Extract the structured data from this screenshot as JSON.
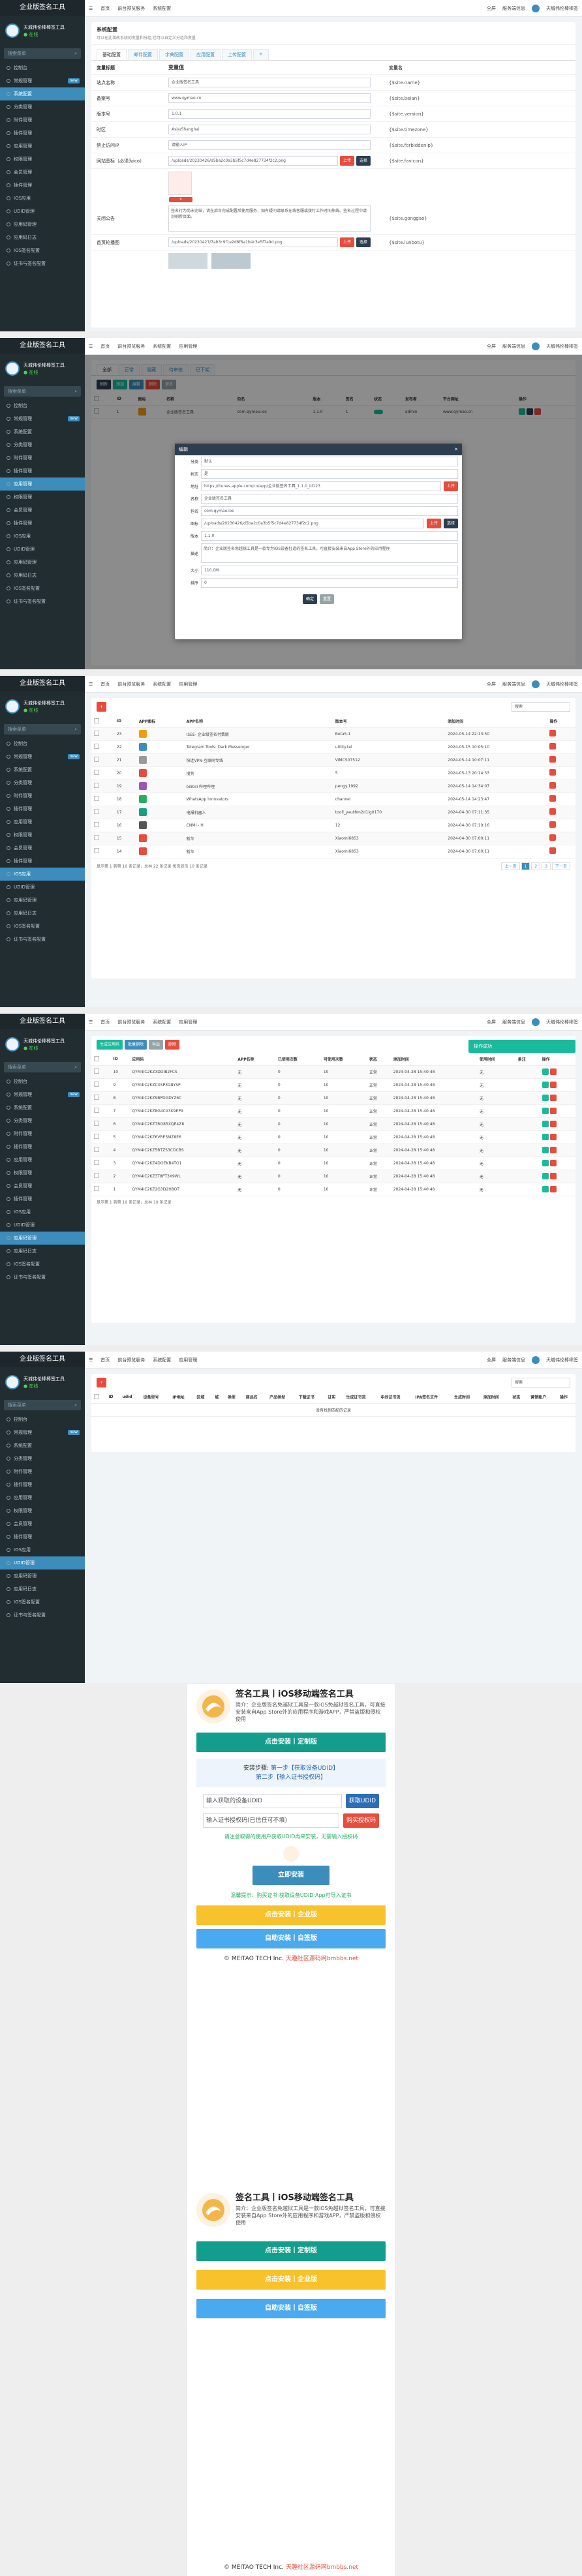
{
  "app": {
    "brand": "企业版签名工具",
    "user_line1": "天城伟伦棒棒签工具",
    "online": "● 在线",
    "search_placeholder": "搜索菜单",
    "topnav": [
      "首页",
      "前台预览服务",
      "系统配置"
    ],
    "topnav_extra": "应用管理",
    "top_right": [
      "全屏",
      "服务端信息",
      "天城伟伦棒棒签"
    ]
  },
  "sidebar": [
    {
      "label": "控制台",
      "badge": ""
    },
    {
      "label": "常规管理",
      "badge": "new"
    },
    {
      "label": "系统配置",
      "badge": ""
    },
    {
      "label": "分类管理",
      "badge": ""
    },
    {
      "label": "附件管理",
      "badge": ""
    },
    {
      "label": "插件管理",
      "badge": ""
    },
    {
      "label": "应用管理",
      "badge": ""
    },
    {
      "label": "权限管理",
      "badge": ""
    },
    {
      "label": "会员管理",
      "badge": ""
    },
    {
      "label": "插件管理",
      "badge": ""
    },
    {
      "label": "IOS应用",
      "badge": ""
    },
    {
      "label": "UDID管理",
      "badge": ""
    },
    {
      "label": "应用码管理",
      "badge": ""
    },
    {
      "label": "应用码日志",
      "badge": ""
    },
    {
      "label": "IOS签名配置",
      "badge": ""
    },
    {
      "label": "证书与签名配置",
      "badge": ""
    }
  ],
  "s1": {
    "title": "系统配置",
    "subtitle": "可以在此增改系统的变量和分组,也可以自定义分组和变量",
    "tabs": [
      "基础配置",
      "邮件配置",
      "字典配置",
      "应用配置",
      "上传配置",
      "+"
    ],
    "cols": [
      "变量标题",
      "变量值",
      "变量名"
    ],
    "rows": [
      {
        "label": "站点名称",
        "value": "企业版签名工具",
        "name": "{$site.name}"
      },
      {
        "label": "备案号",
        "value": "www.qymao.cn",
        "name": "{$site.beian}"
      },
      {
        "label": "版本号",
        "value": "1.0.1",
        "name": "{$site.version}"
      },
      {
        "label": "时区",
        "value": "Asia/Shanghai",
        "name": "{$site.timezone}"
      },
      {
        "label": "禁止访问IP",
        "value": "请输入IP",
        "name": "{$site.forbiddenip}"
      },
      {
        "label": "网站图标（必须为ico）",
        "value": "/uploads/20230426/d5ba2c0a3b5f5c7d4e827734f2c2.png",
        "name": "{$site.favicon}"
      },
      {
        "label": "关闭公告",
        "value": "签名行为尚未完结，请在后台完成配置后使用服务，如有疑问请联系在线客服或拨打工作时间热线。签名过程中请勿刷新页面。",
        "name": "{$site.gonggao}"
      },
      {
        "label": "首页轮播图",
        "value": "/uploads/20230427/7ab3c9f1e2d8f6a1b4c3e5f7a9d.png",
        "name": "{$site.lunbotu}"
      }
    ],
    "btn_upload": "上传",
    "btn_choose": "选择"
  },
  "s2": {
    "tabs": [
      "全部",
      "正常",
      "隐藏",
      "待审核",
      "已下架"
    ],
    "tool": [
      "刷新",
      "添加",
      "编辑",
      "删除",
      "更多"
    ],
    "cols": [
      "ID",
      "图标",
      "名称",
      "包名",
      "版本",
      "签名",
      "状态",
      "发布者",
      "平台网址",
      "操作"
    ],
    "row": {
      "id": "1",
      "name": "企业版签名工具",
      "bundle": "com.qymao.ios",
      "ver": "1.1.0",
      "sign": "1",
      "status": "正常",
      "pub": "admin",
      "url": "www.qymao.cn",
      "plat": "企业版签名工具"
    },
    "modal": {
      "title": "编辑",
      "fields": [
        {
          "label": "分类",
          "value": "默认"
        },
        {
          "label": "状态",
          "value": "是"
        },
        {
          "label": "地址",
          "value": "https://itunes.apple.com/cn/app/企业版签名工具_1.1.0_id123"
        },
        {
          "label": "名称",
          "value": "企业版签名工具"
        },
        {
          "label": "包名",
          "value": "com.qymao.ios"
        },
        {
          "label": "图标",
          "value": "/uploads/20230426/d5ba2c0a3b5f5c7d4e827734f2c2.png"
        },
        {
          "label": "版本",
          "value": "1.1.0"
        },
        {
          "label": "描述",
          "value": "简介：企业版签名免越狱工具是一款专为iOS设备打造的签名工具，可直接安装来自App Store外的应用程序"
        },
        {
          "label": "大小",
          "value": "110.0M"
        },
        {
          "label": "排序",
          "value": "0"
        }
      ],
      "ok": "确定",
      "reset": "重置"
    }
  },
  "s3": {
    "search": "搜索",
    "cols": [
      "ID",
      "APP图标",
      "APP名称",
      "版本号",
      "添加时间",
      "操作"
    ],
    "rows": [
      {
        "id": "23",
        "name": "ISEE- 企业级签名付费版",
        "ver": "Beta5.1",
        "time": "2024-05-14 22:13:50",
        "color": "#f39c12"
      },
      {
        "id": "22",
        "name": "Telegram Tools: Dark Messenger",
        "ver": "utility.tel",
        "time": "2024-05-15 10:05:10",
        "color": "#3c8dbc"
      },
      {
        "id": "21",
        "name": "快连VPN-互联网专线",
        "ver": "ViMCS07512",
        "time": "2024-05-14 10:07:11",
        "color": "#999"
      },
      {
        "id": "20",
        "name": "搜狗",
        "ver": "5",
        "time": "2024-05-13 20:14:33",
        "color": "#e74c3c"
      },
      {
        "id": "19",
        "name": "bilibili 哔哩哔哩",
        "ver": "pengy.1992",
        "time": "2024-05-14 14:34:07",
        "color": "#9b59b6"
      },
      {
        "id": "18",
        "name": "WhatsApp Innovators",
        "ver": "channel",
        "time": "2024-05-14 14:23:47",
        "color": "#27ae60"
      },
      {
        "id": "17",
        "name": "电报机器人",
        "ver": "tooll_yaut8m2d1ig0170",
        "time": "2024-04-30 07:11:35",
        "color": "#16a085"
      },
      {
        "id": "16",
        "name": "CNMI - H",
        "ver": "12",
        "time": "2024-04-30 07:10:16",
        "color": "#555"
      },
      {
        "id": "15",
        "name": "新华",
        "ver": "Xiaomi6853",
        "time": "2024-04-30 07:00:11",
        "color": "#e74c3c"
      },
      {
        "id": "14",
        "name": "新华",
        "ver": "Xiaomi6853",
        "time": "2024-04-30 07:00:11",
        "color": "#e74c3c"
      }
    ],
    "footer": "显示第 1 到第 10 条记录，总共 22 条记录 每页显示 10 条记录",
    "pages": [
      "上一页",
      "1",
      "2",
      "3",
      "下一页"
    ]
  },
  "s4": {
    "tool": [
      "生成应用码",
      "批量删除",
      "导出",
      "删除"
    ],
    "notice": "操作成功",
    "cols": [
      "ID",
      "应用码",
      "APP名称",
      "已使用次数",
      "可使用次数",
      "状态",
      "添加时间",
      "使用时间",
      "备注",
      "操作"
    ],
    "rows": [
      {
        "id": "10",
        "code": "QYM4IC2KZ3DDIB2FCS",
        "app": "无",
        "used": "0",
        "can": "10",
        "st": "正常",
        "time": "2024-04-28 15:40:48",
        "ut": "无"
      },
      {
        "id": "9",
        "code": "QYM4IC2KZCXSP3G8YSP",
        "app": "无",
        "used": "0",
        "can": "10",
        "st": "正常",
        "time": "2024-04-28 15:40:48",
        "ut": "无"
      },
      {
        "id": "8",
        "code": "QYM4IC2KZ9BPDGDYZ6C",
        "app": "无",
        "used": "0",
        "can": "10",
        "st": "正常",
        "time": "2024-04-28 15:40:48",
        "ut": "无"
      },
      {
        "id": "7",
        "code": "QYM4IC2KZ8G4CX3K9EP9",
        "app": "无",
        "used": "0",
        "can": "10",
        "st": "正常",
        "time": "2024-04-28 15:40:48",
        "ut": "无"
      },
      {
        "id": "6",
        "code": "QYM4IC2KZ7RO85XQE4Z8",
        "app": "无",
        "used": "0",
        "can": "10",
        "st": "正常",
        "time": "2024-04-28 15:40:48",
        "ut": "无"
      },
      {
        "id": "5",
        "code": "QYM4IC2KZ6VRE5MZ8E6",
        "app": "无",
        "used": "0",
        "can": "10",
        "st": "正常",
        "time": "2024-04-28 15:40:48",
        "ut": "无"
      },
      {
        "id": "4",
        "code": "QYM4IC2KZ5BTZS3CDCBS",
        "app": "无",
        "used": "0",
        "can": "10",
        "st": "正常",
        "time": "2024-04-28 15:40:48",
        "ut": "无"
      },
      {
        "id": "3",
        "code": "QYM4IC2KZ4DOEKB4TO1",
        "app": "无",
        "used": "0",
        "can": "10",
        "st": "正常",
        "time": "2024-04-28 15:40:48",
        "ut": "无"
      },
      {
        "id": "2",
        "code": "QYM4IC2KZ3T8PT3X9WL",
        "app": "无",
        "used": "0",
        "can": "10",
        "st": "正常",
        "time": "2024-04-28 15:40:48",
        "ut": "无"
      },
      {
        "id": "1",
        "code": "QYM4IC2KZ2G3D2H8OT",
        "app": "无",
        "used": "0",
        "can": "10",
        "st": "正常",
        "time": "2024-04-28 15:40:48",
        "ut": "无"
      }
    ],
    "footer": "显示第 1 到第 10 条记录，总共 10 条记录"
  },
  "s5": {
    "cols": [
      "ID",
      "udid",
      "设备型号",
      "IP地址",
      "区域",
      "城",
      "类型",
      "商品名",
      "产品类型",
      "下载证书",
      "证实",
      "生成证书流",
      "中间证书流",
      "IPA签名文件",
      "生成时间",
      "添加时间",
      "状态",
      "营销账户",
      "操作"
    ],
    "empty": "没有找到匹配的记录"
  },
  "mobile": {
    "title": "签名工具丨iOS移动端签名工具",
    "desc": "简介：企业版签名免越狱工具是一款iOS免越狱签名工具，可直接安装来自App Store外的应用程序和游戏APP，严禁盗版和侵权使用",
    "btn_top": "点击安装丨定制版",
    "steps_title": "安装步骤:",
    "step1": "第一步【获取设备UDID】",
    "step2": "第二步【输入证书授权码】",
    "udid_ph": "输入获取的设备UDID",
    "udid_btn": "获取UDID",
    "code_ph": "输入证书授权码(已信任可不填)",
    "code_btn": "购买授权码",
    "warn": "请注意取得的使用户获取UDID再来安装，无需输入授权码",
    "install": "立即安装",
    "tip": "温馨提示：购买证书·获取设备UDID·App可导入证书",
    "btn_company": "点击安装丨企业版",
    "btn_self": "自助安装丨自签版",
    "copyright": "© MEITAO TECH Inc.",
    "copyright_link": "天趣社区源码网bmbbs.net",
    "bottom_btn1": "点击安装丨定制版",
    "bottom_btn2": "点击安装丨企业版",
    "bottom_btn3": "自助安装丨自签版",
    "colors": {
      "teal": "#139d8c",
      "blue": "#3c8dbc",
      "amber": "#f7c22c",
      "sky": "#49aaf0"
    }
  }
}
